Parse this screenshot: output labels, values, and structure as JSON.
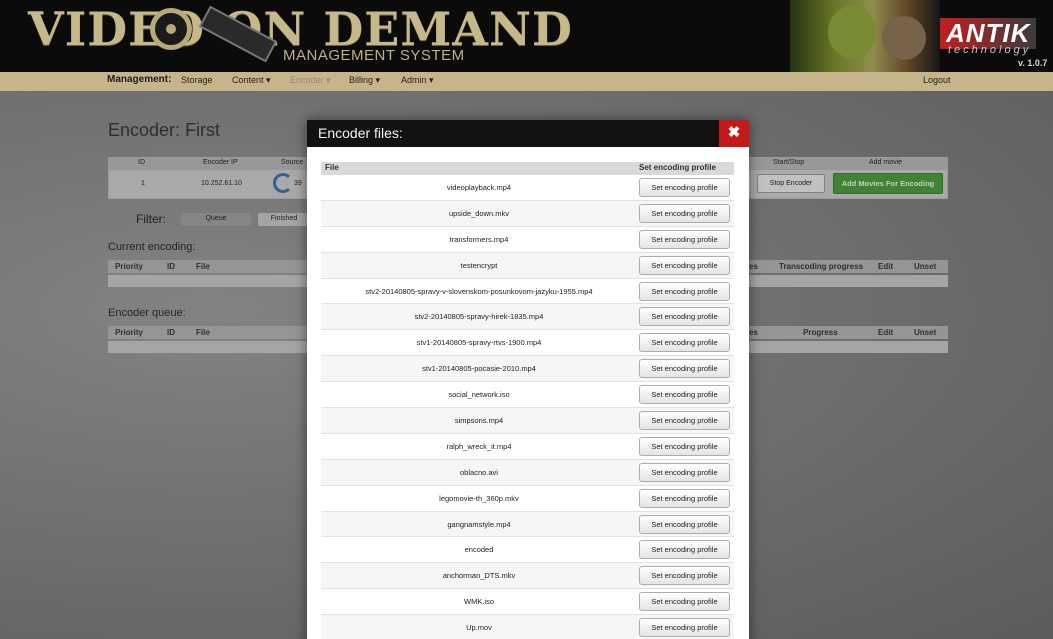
{
  "header": {
    "logo_text": "VIDEO ON DEMAND",
    "logo_sub": "MANAGEMENT SYSTEM",
    "brand": "ANTIK",
    "brand_sub": "technology",
    "version": "v. 1.0.7"
  },
  "nav": {
    "label": "Management:",
    "items": [
      {
        "label": "Storage"
      },
      {
        "label": "Content ▾"
      },
      {
        "label": "Encoder ▾"
      },
      {
        "label": "Billing ▾"
      },
      {
        "label": "Admin ▾"
      }
    ],
    "logout": "Logout"
  },
  "page": {
    "title_prefix": "Encoder:",
    "title_name": "First",
    "encoder_table": {
      "headers": [
        "ID",
        "Encoder IP",
        "Source",
        "Start/Stop",
        "Add movie"
      ],
      "row": {
        "id": "1",
        "ip": "10.252.61.10",
        "source": "39"
      },
      "stop_label": "Stop Encoder",
      "add_label": "Add Movies For Encoding"
    },
    "filter": {
      "label": "Filter:",
      "queue": "Queue",
      "finished": "Finished"
    },
    "current_encoding": {
      "title": "Current encoding:",
      "headers": [
        "Priority",
        "ID",
        "File",
        "es",
        "Transcoding progress",
        "Edit",
        "Unset"
      ]
    },
    "encoder_queue": {
      "title": "Encoder queue:",
      "headers": [
        "Priority",
        "ID",
        "File",
        "es",
        "Progress",
        "Edit",
        "Unset"
      ]
    }
  },
  "modal": {
    "title": "Encoder files:",
    "close_icon": "✖",
    "col_file": "File",
    "col_profile": "Set encoding profile",
    "button_label": "Set encoding profile",
    "files": [
      "videoplayback.mp4",
      "upside_down.mkv",
      "transformers.mp4",
      "testencrypt",
      "stv2-20140805-spravy-v-slovenskom-posunkovom-jazyku-1955.mp4",
      "stv2-20140805-spravy-hirek-1835.mp4",
      "stv1-20140805-spravy-rtvs-1900.mp4",
      "stv1-20140805-pocasie-2010.mp4",
      "social_network.iso",
      "simpsons.mp4",
      "ralph_wreck_it.mp4",
      "oblacno.avi",
      "legomovie-th_360p.mkv",
      "gangnamstyle.mp4",
      "encoded",
      "anchorman_DTS.mkv",
      "WMK.iso",
      "Up.mov"
    ]
  }
}
